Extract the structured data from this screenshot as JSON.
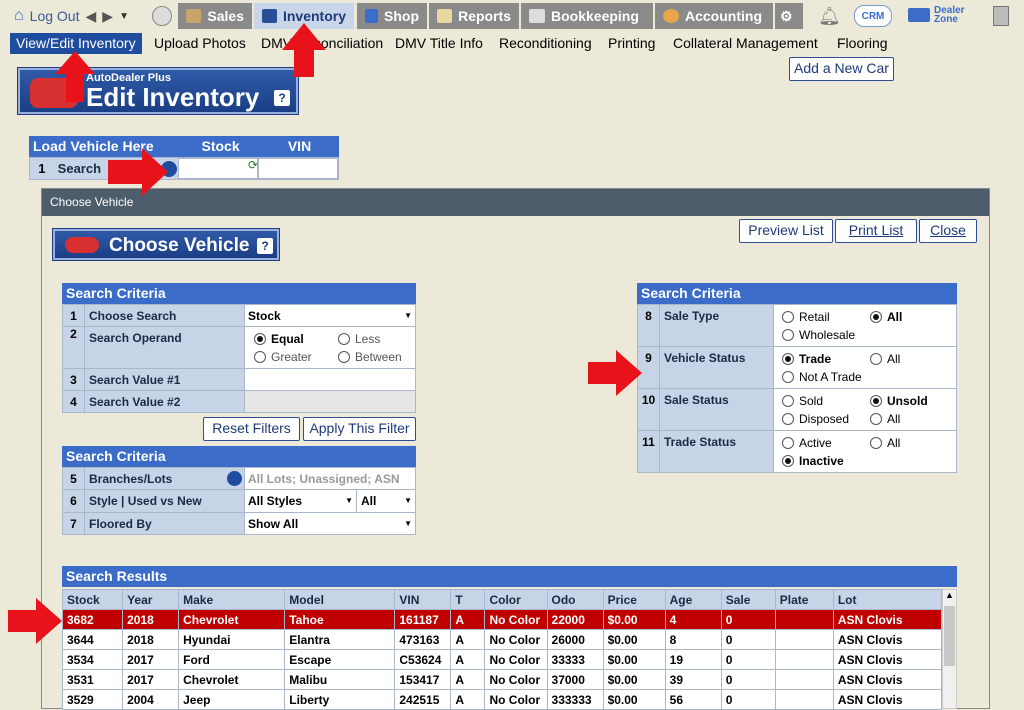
{
  "topnav": {
    "logout": "Log Out",
    "sales": "Sales",
    "inventory": "Inventory",
    "shop": "Shop",
    "reports": "Reports",
    "bookkeeping": "Bookkeeping",
    "accounting": "Accounting",
    "crm": "CRM",
    "dealer_zone": "Dealer Zone"
  },
  "subnav": [
    "View/Edit Inventory",
    "Upload Photos",
    "DMV Reconciliation",
    "DMV Title Info",
    "Reconditioning",
    "Printing",
    "Collateral Management",
    "Flooring"
  ],
  "add_new_car": "Add a New Car",
  "edit_title": {
    "brand": "AutoDealer Plus",
    "title": "Edit Inventory",
    "help": "?"
  },
  "load_vehicle": {
    "header": "Load Vehicle Here",
    "col_stock": "Stock",
    "col_vin": "VIN",
    "row_num": "1",
    "row_label": "Search"
  },
  "choose_panel": {
    "title": "Choose Vehicle",
    "banner": "Choose Vehicle",
    "help": "?",
    "preview": "Preview List",
    "print": "Print List",
    "close": "Close"
  },
  "criteria1": {
    "header": "Search Criteria",
    "rows": [
      {
        "n": "1",
        "label": "Choose Search",
        "value": "Stock"
      },
      {
        "n": "2",
        "label": "Search Operand",
        "opts": [
          "Equal",
          "Less",
          "Greater",
          "Between"
        ],
        "selected": "Equal"
      },
      {
        "n": "3",
        "label": "Search Value #1",
        "value": ""
      },
      {
        "n": "4",
        "label": "Search Value #2",
        "value": ""
      }
    ],
    "reset": "Reset Filters",
    "apply": "Apply This Filter"
  },
  "criteria2": {
    "header": "Search Criteria",
    "rows": [
      {
        "n": "5",
        "label": "Branches/Lots",
        "value": "All Lots; Unassigned; ASN"
      },
      {
        "n": "6",
        "label": "Style | Used vs New",
        "value": "All Styles",
        "value2": "All"
      },
      {
        "n": "7",
        "label": "Floored By",
        "value": "Show All"
      }
    ]
  },
  "criteria3": {
    "header": "Search Criteria",
    "rows": [
      {
        "n": "8",
        "label": "Sale Type",
        "a": "Retail",
        "b": "All",
        "c": "Wholesale",
        "sel": "b"
      },
      {
        "n": "9",
        "label": "Vehicle Status",
        "a": "Trade",
        "b": "All",
        "c": "Not A Trade",
        "sel": "a"
      },
      {
        "n": "10",
        "label": "Sale Status",
        "a": "Sold",
        "b": "Unsold",
        "c": "Disposed",
        "d": "All",
        "sel": "b"
      },
      {
        "n": "11",
        "label": "Trade Status",
        "a": "Active",
        "b": "All",
        "c": "Inactive",
        "sel": "c"
      }
    ]
  },
  "results": {
    "header": "Search Results",
    "columns": [
      "Stock",
      "Year",
      "Make",
      "Model",
      "VIN",
      "T",
      "Color",
      "Odo",
      "Price",
      "Age",
      "Sale",
      "Plate",
      "Lot"
    ],
    "rows": [
      [
        "3682",
        "2018",
        "Chevrolet",
        "Tahoe",
        "161187",
        "A",
        "No Color",
        "22000",
        "$0.00",
        "4",
        "0",
        "",
        "ASN Clovis"
      ],
      [
        "3644",
        "2018",
        "Hyundai",
        "Elantra",
        "473163",
        "A",
        "No Color",
        "26000",
        "$0.00",
        "8",
        "0",
        "",
        "ASN Clovis"
      ],
      [
        "3534",
        "2017",
        "Ford",
        "Escape",
        "C53624",
        "A",
        "No Color",
        "33333",
        "$0.00",
        "19",
        "0",
        "",
        "ASN Clovis"
      ],
      [
        "3531",
        "2017",
        "Chevrolet",
        "Malibu",
        "153417",
        "A",
        "No Color",
        "37000",
        "$0.00",
        "39",
        "0",
        "",
        "ASN Clovis"
      ],
      [
        "3529",
        "2004",
        "Jeep",
        "Liberty",
        "242515",
        "A",
        "No Color",
        "333333",
        "$0.00",
        "56",
        "0",
        "",
        "ASN Clovis"
      ]
    ]
  },
  "colors": {
    "accent": "#1e4c9e",
    "header": "#3a6cc8",
    "arrow": "#e8131a",
    "selected_row": "#c00000"
  }
}
